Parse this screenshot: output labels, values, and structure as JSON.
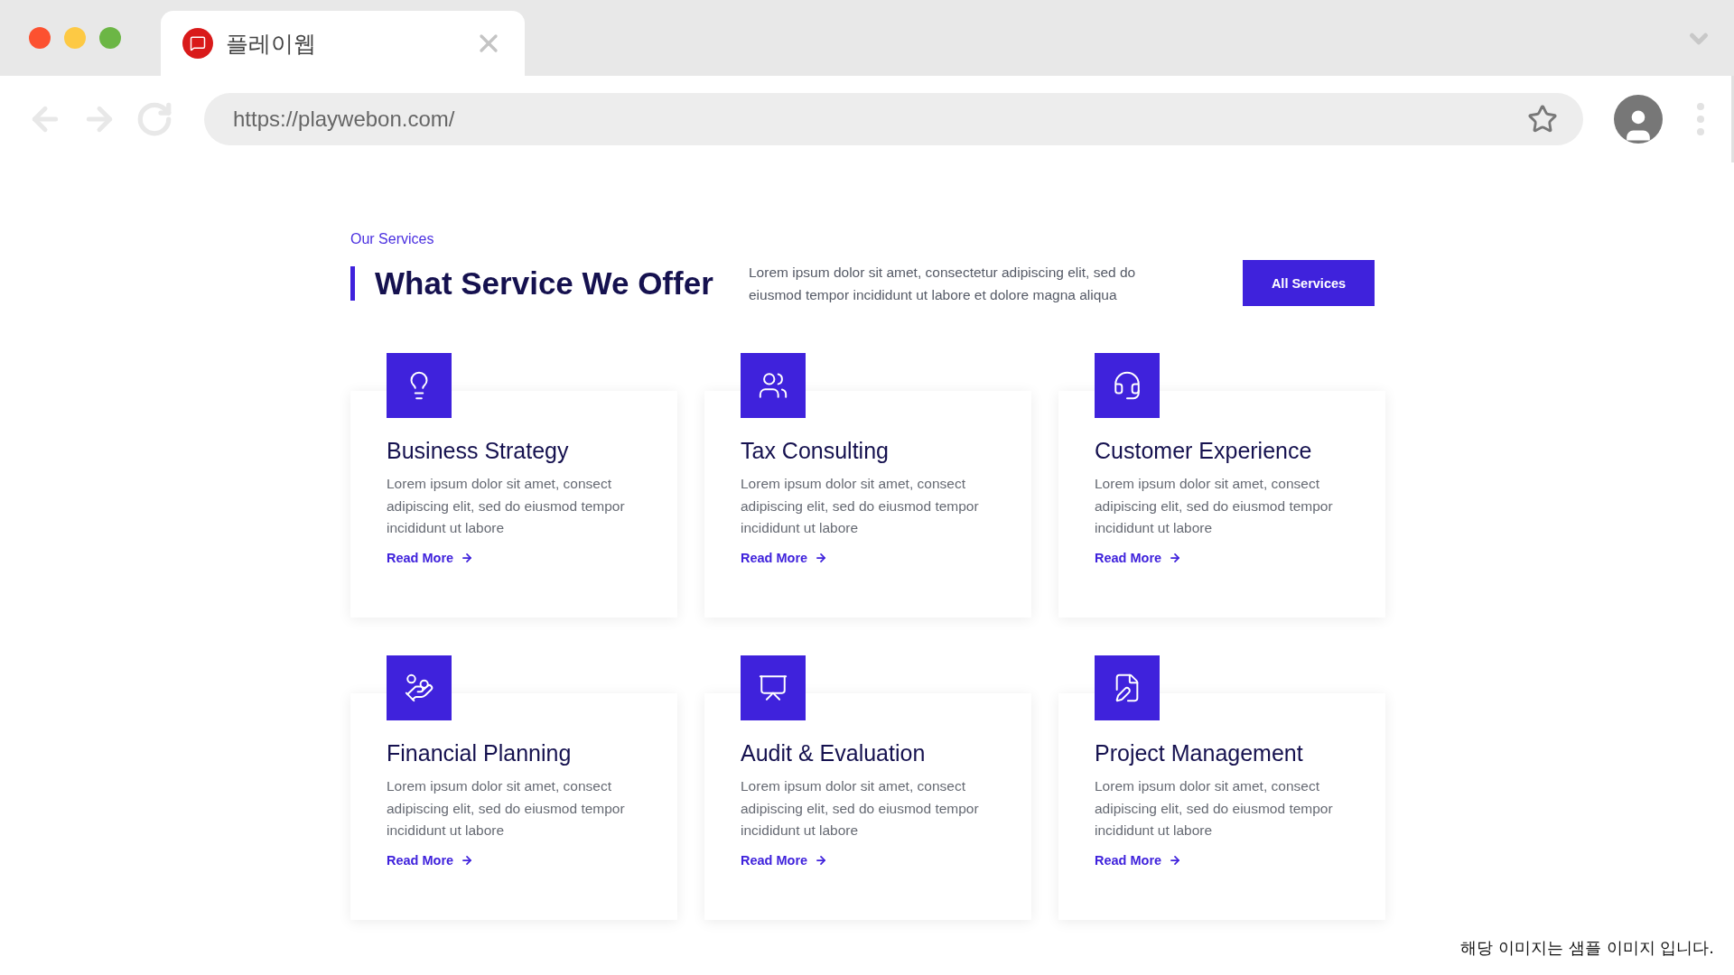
{
  "browser": {
    "tab": {
      "title": "플레이웹"
    },
    "address": "https://playwebon.com/"
  },
  "section": {
    "eyebrow": "Our Services",
    "title": "What Service We Offer",
    "intro": "Lorem ipsum dolor sit amet, consectetur adipiscing elit, sed do eiusmod tempor incididunt ut labore et dolore magna aliqua",
    "button": "All Services"
  },
  "services": [
    {
      "title": "Business Strategy",
      "text": "Lorem ipsum dolor sit amet, consect adipiscing elit, sed do eiusmod tempor incididunt ut labore",
      "link": "Read More"
    },
    {
      "title": "Tax Consulting",
      "text": "Lorem ipsum dolor sit amet, consect adipiscing elit, sed do eiusmod tempor incididunt ut labore",
      "link": "Read More"
    },
    {
      "title": "Customer Experience",
      "text": "Lorem ipsum dolor sit amet, consect adipiscing elit, sed do eiusmod tempor incididunt ut labore",
      "link": "Read More"
    },
    {
      "title": "Financial Planning",
      "text": "Lorem ipsum dolor sit amet, consect adipiscing elit, sed do eiusmod tempor incididunt ut labore",
      "link": "Read More"
    },
    {
      "title": "Audit & Evaluation",
      "text": "Lorem ipsum dolor sit amet, consect adipiscing elit, sed do eiusmod tempor incididunt ut labore",
      "link": "Read More"
    },
    {
      "title": "Project Management",
      "text": "Lorem ipsum dolor sit amet, consect adipiscing elit, sed do eiusmod tempor incididunt ut labore",
      "link": "Read More"
    }
  ],
  "note": "해당 이미지는 샘플 이미지 입니다."
}
